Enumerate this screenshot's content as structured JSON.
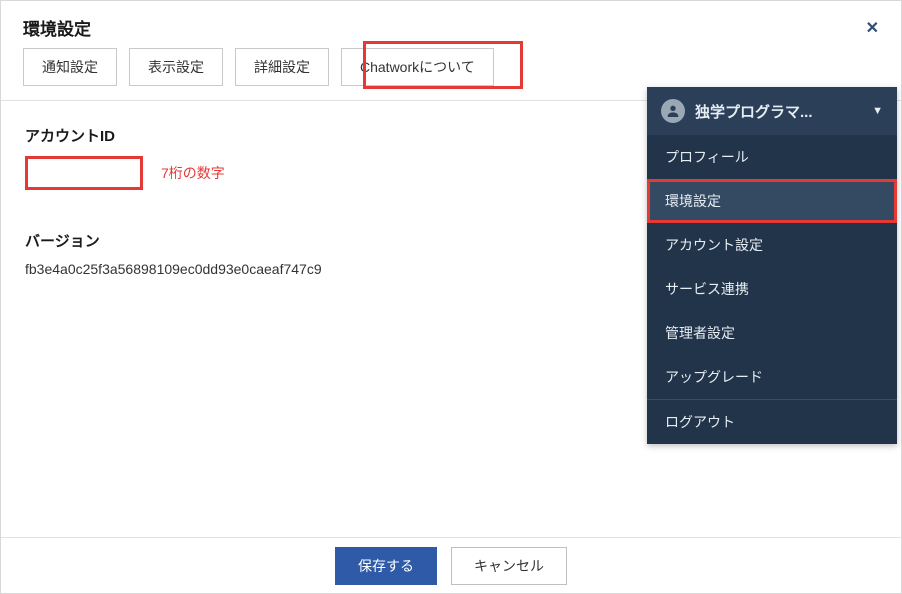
{
  "dialog": {
    "title": "環境設定"
  },
  "tabs": {
    "notify": "通知設定",
    "display": "表示設定",
    "detail": "詳細設定",
    "about": "Chatworkについて"
  },
  "account": {
    "label": "アカウントID",
    "hint": "7桁の数字"
  },
  "version": {
    "label": "バージョン",
    "value": "fb3e4a0c25f3a56898109ec0dd93e0caeaf747c9"
  },
  "menu": {
    "username": "独学プログラマ...",
    "items": {
      "profile": "プロフィール",
      "settings": "環境設定",
      "account": "アカウント設定",
      "services": "サービス連携",
      "admin": "管理者設定",
      "upgrade": "アップグレード",
      "logout": "ログアウト"
    }
  },
  "footer": {
    "save": "保存する",
    "cancel": "キャンセル"
  }
}
